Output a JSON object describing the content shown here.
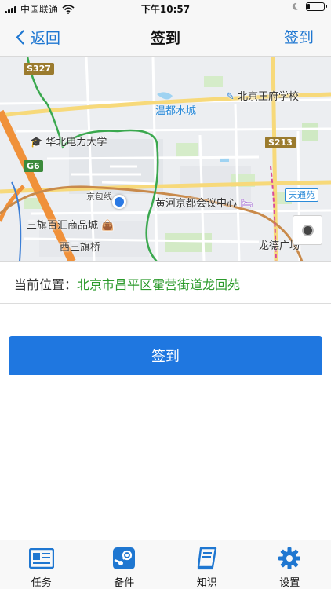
{
  "status_bar": {
    "carrier": "中国联通",
    "time": "下午10:57",
    "battery_level": 0.15
  },
  "nav": {
    "back_label": "返回",
    "title": "签到",
    "action_label": "签到"
  },
  "map": {
    "labels": {
      "s327": "S327",
      "beijing_wangfu_school": "北京王府学校",
      "wendu_water_city": "温都水城",
      "ncepu": "华北电力大学",
      "s213": "S213",
      "g6": "G6",
      "jingbao_line": "京包线",
      "huanghe_convention": "黄河京都会议中心",
      "tiantongyuan": "天通苑",
      "sanqi_mall": "三旗百汇商品城",
      "xisanqi_bridge": "西三旗桥",
      "longde_plaza": "龙德广场"
    },
    "colors": {
      "highway": "#f0913a",
      "railway": "#c98a4b",
      "district_boundary": "#3aa84e",
      "water": "#9fd3f2"
    }
  },
  "location": {
    "label": "当前位置：",
    "value": "北京市昌平区霍营街道龙回苑"
  },
  "checkin_button": {
    "label": "签到"
  },
  "tab_bar": {
    "items": [
      {
        "label": "任务",
        "icon": "newspaper-icon"
      },
      {
        "label": "备件",
        "icon": "steam-icon"
      },
      {
        "label": "知识",
        "icon": "book-icon"
      },
      {
        "label": "设置",
        "icon": "gear-icon"
      }
    ],
    "colors": {
      "icon": "#1f77d1"
    }
  }
}
